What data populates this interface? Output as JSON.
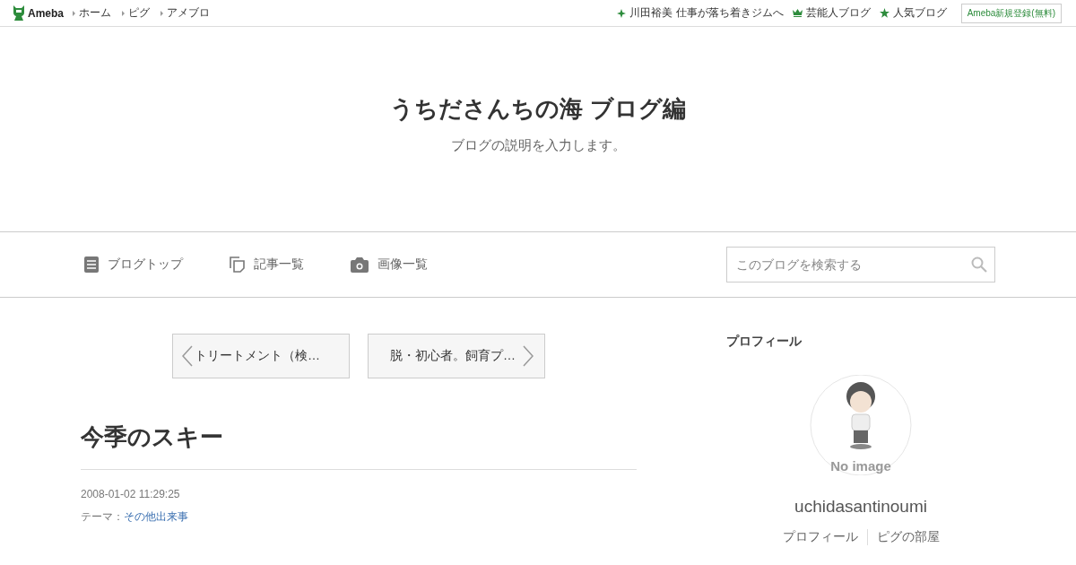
{
  "top_bar": {
    "logo": "Ameba",
    "links": [
      "ホーム",
      "ピグ",
      "アメブロ"
    ],
    "right_links": [
      {
        "kind": "sparkle",
        "label": "川田裕美 仕事が落ち着きジムへ"
      },
      {
        "kind": "crown",
        "label": "芸能人ブログ"
      },
      {
        "kind": "star",
        "label": "人気ブログ"
      }
    ],
    "register_button": "Ameba新規登録(無料)"
  },
  "header": {
    "title": "うちださんちの海 ブログ編",
    "description": "ブログの説明を入力します。"
  },
  "nav": {
    "items": [
      {
        "kind": "document",
        "label": "ブログトップ"
      },
      {
        "kind": "copy",
        "label": "記事一覧"
      },
      {
        "kind": "camera",
        "label": "画像一覧"
      }
    ],
    "search": {
      "placeholder": "このブログを検索する"
    }
  },
  "entry": {
    "prev": "トリートメント（検…",
    "next": "脱・初心者。飼育プ…",
    "title": "今季のスキー",
    "date": "2008-01-02 11:29:25",
    "theme_label": "テーマ：",
    "theme": "その他出来事"
  },
  "profile": {
    "heading": "プロフィール",
    "avatar_caption": "No image",
    "name": "uchidasantinoumi",
    "links": [
      "プロフィール",
      "ピグの部屋"
    ]
  }
}
